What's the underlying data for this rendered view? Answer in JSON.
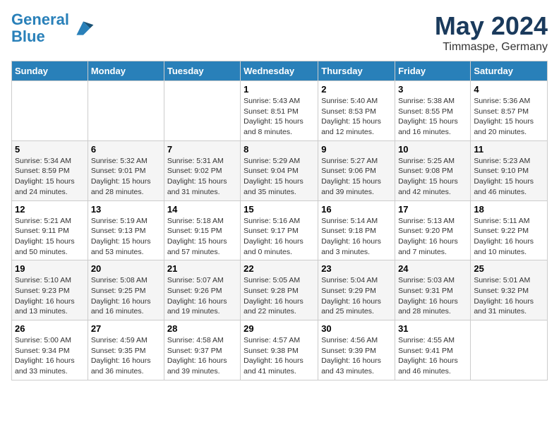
{
  "header": {
    "logo_line1": "General",
    "logo_line2": "Blue",
    "month_title": "May 2024",
    "location": "Timmaspe, Germany"
  },
  "days_of_week": [
    "Sunday",
    "Monday",
    "Tuesday",
    "Wednesday",
    "Thursday",
    "Friday",
    "Saturday"
  ],
  "weeks": [
    [
      {
        "day": "",
        "info": ""
      },
      {
        "day": "",
        "info": ""
      },
      {
        "day": "",
        "info": ""
      },
      {
        "day": "1",
        "info": "Sunrise: 5:43 AM\nSunset: 8:51 PM\nDaylight: 15 hours\nand 8 minutes."
      },
      {
        "day": "2",
        "info": "Sunrise: 5:40 AM\nSunset: 8:53 PM\nDaylight: 15 hours\nand 12 minutes."
      },
      {
        "day": "3",
        "info": "Sunrise: 5:38 AM\nSunset: 8:55 PM\nDaylight: 15 hours\nand 16 minutes."
      },
      {
        "day": "4",
        "info": "Sunrise: 5:36 AM\nSunset: 8:57 PM\nDaylight: 15 hours\nand 20 minutes."
      }
    ],
    [
      {
        "day": "5",
        "info": "Sunrise: 5:34 AM\nSunset: 8:59 PM\nDaylight: 15 hours\nand 24 minutes."
      },
      {
        "day": "6",
        "info": "Sunrise: 5:32 AM\nSunset: 9:01 PM\nDaylight: 15 hours\nand 28 minutes."
      },
      {
        "day": "7",
        "info": "Sunrise: 5:31 AM\nSunset: 9:02 PM\nDaylight: 15 hours\nand 31 minutes."
      },
      {
        "day": "8",
        "info": "Sunrise: 5:29 AM\nSunset: 9:04 PM\nDaylight: 15 hours\nand 35 minutes."
      },
      {
        "day": "9",
        "info": "Sunrise: 5:27 AM\nSunset: 9:06 PM\nDaylight: 15 hours\nand 39 minutes."
      },
      {
        "day": "10",
        "info": "Sunrise: 5:25 AM\nSunset: 9:08 PM\nDaylight: 15 hours\nand 42 minutes."
      },
      {
        "day": "11",
        "info": "Sunrise: 5:23 AM\nSunset: 9:10 PM\nDaylight: 15 hours\nand 46 minutes."
      }
    ],
    [
      {
        "day": "12",
        "info": "Sunrise: 5:21 AM\nSunset: 9:11 PM\nDaylight: 15 hours\nand 50 minutes."
      },
      {
        "day": "13",
        "info": "Sunrise: 5:19 AM\nSunset: 9:13 PM\nDaylight: 15 hours\nand 53 minutes."
      },
      {
        "day": "14",
        "info": "Sunrise: 5:18 AM\nSunset: 9:15 PM\nDaylight: 15 hours\nand 57 minutes."
      },
      {
        "day": "15",
        "info": "Sunrise: 5:16 AM\nSunset: 9:17 PM\nDaylight: 16 hours\nand 0 minutes."
      },
      {
        "day": "16",
        "info": "Sunrise: 5:14 AM\nSunset: 9:18 PM\nDaylight: 16 hours\nand 3 minutes."
      },
      {
        "day": "17",
        "info": "Sunrise: 5:13 AM\nSunset: 9:20 PM\nDaylight: 16 hours\nand 7 minutes."
      },
      {
        "day": "18",
        "info": "Sunrise: 5:11 AM\nSunset: 9:22 PM\nDaylight: 16 hours\nand 10 minutes."
      }
    ],
    [
      {
        "day": "19",
        "info": "Sunrise: 5:10 AM\nSunset: 9:23 PM\nDaylight: 16 hours\nand 13 minutes."
      },
      {
        "day": "20",
        "info": "Sunrise: 5:08 AM\nSunset: 9:25 PM\nDaylight: 16 hours\nand 16 minutes."
      },
      {
        "day": "21",
        "info": "Sunrise: 5:07 AM\nSunset: 9:26 PM\nDaylight: 16 hours\nand 19 minutes."
      },
      {
        "day": "22",
        "info": "Sunrise: 5:05 AM\nSunset: 9:28 PM\nDaylight: 16 hours\nand 22 minutes."
      },
      {
        "day": "23",
        "info": "Sunrise: 5:04 AM\nSunset: 9:29 PM\nDaylight: 16 hours\nand 25 minutes."
      },
      {
        "day": "24",
        "info": "Sunrise: 5:03 AM\nSunset: 9:31 PM\nDaylight: 16 hours\nand 28 minutes."
      },
      {
        "day": "25",
        "info": "Sunrise: 5:01 AM\nSunset: 9:32 PM\nDaylight: 16 hours\nand 31 minutes."
      }
    ],
    [
      {
        "day": "26",
        "info": "Sunrise: 5:00 AM\nSunset: 9:34 PM\nDaylight: 16 hours\nand 33 minutes."
      },
      {
        "day": "27",
        "info": "Sunrise: 4:59 AM\nSunset: 9:35 PM\nDaylight: 16 hours\nand 36 minutes."
      },
      {
        "day": "28",
        "info": "Sunrise: 4:58 AM\nSunset: 9:37 PM\nDaylight: 16 hours\nand 39 minutes."
      },
      {
        "day": "29",
        "info": "Sunrise: 4:57 AM\nSunset: 9:38 PM\nDaylight: 16 hours\nand 41 minutes."
      },
      {
        "day": "30",
        "info": "Sunrise: 4:56 AM\nSunset: 9:39 PM\nDaylight: 16 hours\nand 43 minutes."
      },
      {
        "day": "31",
        "info": "Sunrise: 4:55 AM\nSunset: 9:41 PM\nDaylight: 16 hours\nand 46 minutes."
      },
      {
        "day": "",
        "info": ""
      }
    ]
  ]
}
